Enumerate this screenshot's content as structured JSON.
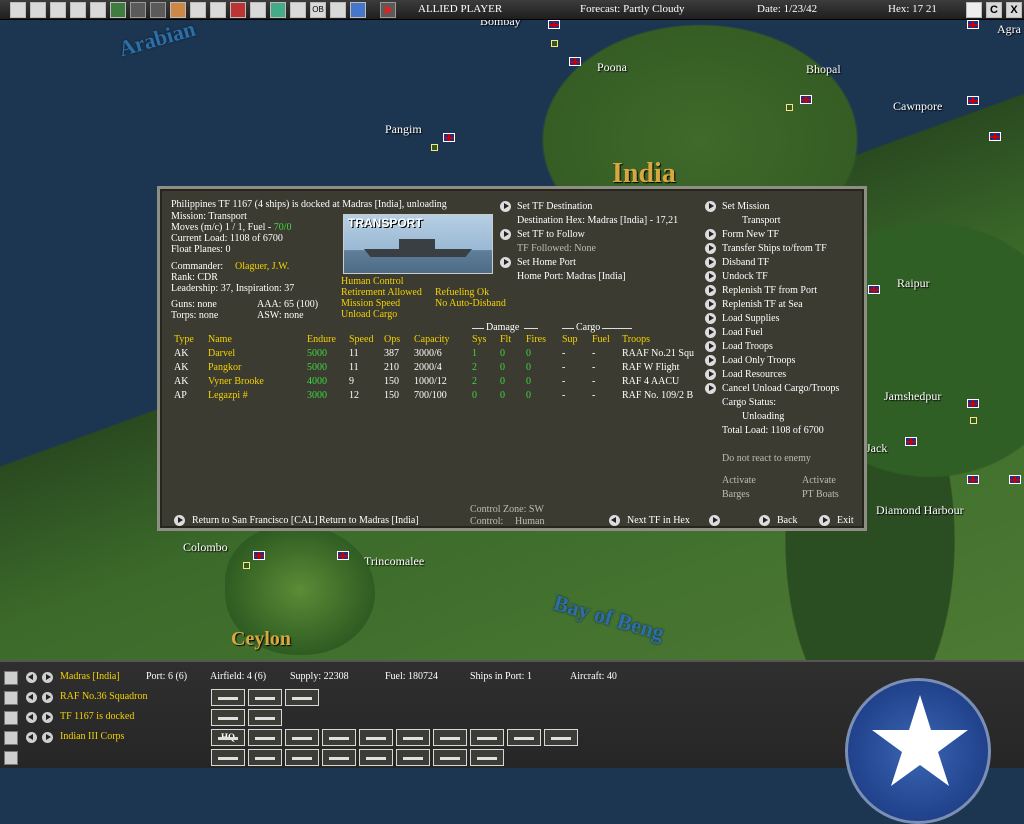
{
  "topbar": {
    "player": "ALLIED PLAYER",
    "forecast": "Forecast: Partly Cloudy",
    "date": "Date: 1/23/42",
    "hex": "Hex: 17 21",
    "toolbar_icons": [
      "save-icon",
      "doc-icon",
      "reports-icon",
      "intel-icon",
      "info-icon",
      "star-icon",
      "plane-icon",
      "plane2-icon",
      "flag-icon",
      "ship-icon",
      "tf-icon",
      "color-icon",
      "unit-icon",
      "globe-icon",
      "settings-icon",
      "ob-icon",
      "list-icon",
      "cloud-icon",
      "end-turn-icon"
    ],
    "ob_label": "OB",
    "right_buttons": {
      "c": "C",
      "x": "X"
    }
  },
  "map": {
    "labels": [
      "Poona",
      "Bhopal",
      "Cawnpore",
      "Pangim",
      "India",
      "Raipur",
      "Jamshedpur",
      "Diamond Harbour",
      "Colombo",
      "Trincomalee",
      "Ceylon",
      "Agra",
      "Bombay",
      "Jack"
    ],
    "seas": [
      "Arabian",
      "Bay of Beng"
    ]
  },
  "dialog": {
    "header": "Philippines TF 1167 (4 ships) is docked at Madras [India], unloading",
    "mission": "Mission:  Transport",
    "moves_prefix": "Moves (m/c)  1 / 1, Fuel - ",
    "moves_fuel": "70/0",
    "current_load": "Current Load:  1108 of 6700",
    "float_planes": "Float Planes:  0",
    "commander_label": "Commander:",
    "commander": "Olaguer, J.W.",
    "rank": "Rank: CDR",
    "leadership": "Leadership: 37, Inspiration: 37",
    "guns": "Guns: none",
    "aaa": "AAA: 65 (100)",
    "torps": "Torps: none",
    "asw": "ASW: none",
    "ship_image_label": "TRANSPORT",
    "flags_left": [
      "Human Control",
      "Retirement Allowed",
      "Mission Speed",
      "Unload Cargo"
    ],
    "flags_right": [
      "Refueling Ok",
      "No Auto-Disband"
    ],
    "mid": {
      "set_destination": "Set TF Destination",
      "destination_hex": "Destination Hex: Madras [India] - 17,21",
      "set_follow": "Set TF to Follow",
      "followed": "TF Followed: None",
      "set_home": "Set Home Port",
      "home_port": "Home Port: Madras [India]"
    },
    "right_menu": {
      "set_mission": "Set Mission",
      "mission_value": "Transport",
      "items": [
        "Form New TF",
        "Transfer Ships to/from TF",
        "Disband TF",
        "Undock TF",
        "Replenish TF from Port",
        "Replenish TF at Sea",
        "Load Supplies",
        "Load Fuel",
        "Load Troops",
        "Load Only Troops",
        "Load Resources",
        "Cancel Unload Cargo/Troops"
      ],
      "cargo_status": "Cargo Status:",
      "cargo_value": "Unloading",
      "total_load": "Total Load: 1108 of 6700",
      "no_react": "Do not react to enemy",
      "activate_barges_1": "Activate",
      "activate_barges_2": "Barges",
      "activate_pt_1": "Activate",
      "activate_pt_2": "PT Boats"
    },
    "table": {
      "group_damage": "Damage",
      "group_cargo": "Cargo",
      "headers": [
        "Type",
        "Name",
        "Endure",
        "Speed",
        "Ops",
        "Capacity",
        "Sys",
        "Flt",
        "Fires",
        "Sup",
        "Fuel",
        "Troops"
      ],
      "rows": [
        {
          "type": "AK",
          "name": "Darvel",
          "endure": "5000",
          "speed": "11",
          "ops": "387",
          "capacity": "3000/6",
          "sys": "1",
          "flt": "0",
          "fires": "0",
          "sup": "-",
          "fuel": "-",
          "troops": "RAAF No.21 Squ"
        },
        {
          "type": "AK",
          "name": "Pangkor",
          "endure": "5000",
          "speed": "11",
          "ops": "210",
          "capacity": "2000/4",
          "sys": "2",
          "flt": "0",
          "fires": "0",
          "sup": "-",
          "fuel": "-",
          "troops": "RAF W Flight"
        },
        {
          "type": "AK",
          "name": "Vyner Brooke",
          "endure": "4000",
          "speed": "9",
          "ops": "150",
          "capacity": "1000/12",
          "sys": "2",
          "flt": "0",
          "fires": "0",
          "sup": "-",
          "fuel": "-",
          "troops": "RAF 4 AACU"
        },
        {
          "type": "AP",
          "name": "Legazpi #",
          "endure": "3000",
          "speed": "12",
          "ops": "150",
          "capacity": "700/100",
          "sys": "0",
          "flt": "0",
          "fires": "0",
          "sup": "-",
          "fuel": "-",
          "troops": "RAF No. 109/2 B"
        }
      ]
    },
    "footer": {
      "return_sf": "Return to San Francisco [CAL]",
      "return_madras": "Return to Madras [India]",
      "control_zone": "Control Zone: SW",
      "control": "Control:",
      "control_value": "Human",
      "next_tf": "Next TF in Hex",
      "back": "Back",
      "exit": "Exit"
    }
  },
  "bottom": {
    "rows": [
      {
        "icon": "anchor-icon",
        "label": "Madras [India]"
      },
      {
        "icon": "plane-icon",
        "label": "RAF No.36 Squadron"
      },
      {
        "icon": "ship-icon",
        "label": "TF 1167 is docked"
      },
      {
        "icon": "flag-icon",
        "label": "Indian III Corps"
      }
    ],
    "port": "Port: 6 (6)",
    "airfield": "Airfield: 4 (6)",
    "supply": "Supply: 22308",
    "fuel": "Fuel: 180724",
    "ships_in_port": "Ships in Port: 1",
    "aircraft": "Aircraft: 40",
    "hq_label": "HQ",
    "last_icon": "unit-icon"
  },
  "colors": {
    "dialog_bg": "#3b3b32",
    "yellow": "#f4d200",
    "green": "#3fd83f",
    "sea": "#1c3550"
  }
}
